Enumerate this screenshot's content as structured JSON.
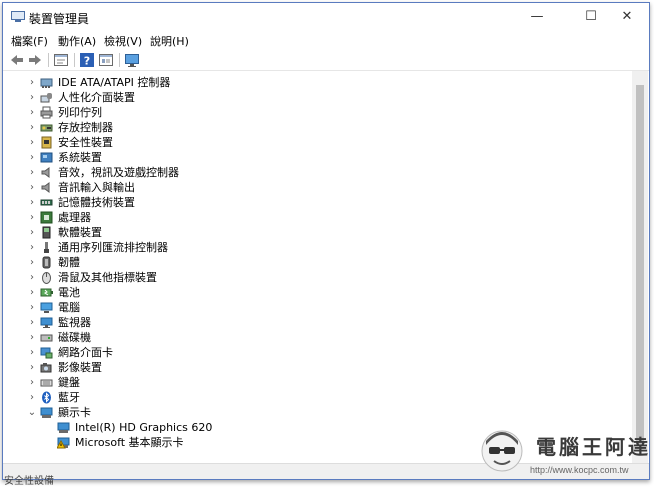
{
  "window": {
    "title": "裝置管理員",
    "minimize": "—",
    "maximize": "☐",
    "close": "✕"
  },
  "menu": [
    {
      "label": "檔案(F)"
    },
    {
      "label": "動作(A)"
    },
    {
      "label": "檢視(V)"
    },
    {
      "label": "說明(H)"
    }
  ],
  "toolbar": {
    "buttons": [
      {
        "icon": "back-arrow-icon"
      },
      {
        "icon": "forward-arrow-icon"
      },
      {
        "icon": "properties-icon"
      },
      {
        "icon": "help-icon"
      },
      {
        "icon": "list-view-icon"
      },
      {
        "icon": "monitor-scan-icon"
      }
    ]
  },
  "tree": {
    "items": [
      {
        "label": "IDE ATA/ATAPI 控制器",
        "icon": "ide-controller-icon",
        "expanded": false
      },
      {
        "label": "人性化介面裝置",
        "icon": "hid-icon",
        "expanded": false
      },
      {
        "label": "列印佇列",
        "icon": "printer-icon",
        "expanded": false
      },
      {
        "label": "存放控制器",
        "icon": "storage-controller-icon",
        "expanded": false
      },
      {
        "label": "安全性裝置",
        "icon": "security-device-icon",
        "expanded": false
      },
      {
        "label": "系統裝置",
        "icon": "system-device-icon",
        "expanded": false
      },
      {
        "label": "音效，視訊及遊戲控制器",
        "icon": "speaker-icon",
        "expanded": false
      },
      {
        "label": "音訊輸入與輸出",
        "icon": "audio-io-icon",
        "expanded": false
      },
      {
        "label": "記憶體技術裝置",
        "icon": "memory-icon",
        "expanded": false
      },
      {
        "label": "處理器",
        "icon": "processor-icon",
        "expanded": false
      },
      {
        "label": "軟體裝置",
        "icon": "software-device-icon",
        "expanded": false
      },
      {
        "label": "通用序列匯流排控制器",
        "icon": "usb-icon",
        "expanded": false
      },
      {
        "label": "韌體",
        "icon": "firmware-icon",
        "expanded": false
      },
      {
        "label": "滑鼠及其他指標裝置",
        "icon": "mouse-icon",
        "expanded": false
      },
      {
        "label": "電池",
        "icon": "battery-icon",
        "expanded": false
      },
      {
        "label": "電腦",
        "icon": "computer-icon",
        "expanded": false
      },
      {
        "label": "監視器",
        "icon": "monitor-icon",
        "expanded": false
      },
      {
        "label": "磁碟機",
        "icon": "disk-drive-icon",
        "expanded": false
      },
      {
        "label": "網路介面卡",
        "icon": "network-adapter-icon",
        "expanded": false
      },
      {
        "label": "影像裝置",
        "icon": "imaging-device-icon",
        "expanded": false
      },
      {
        "label": "鍵盤",
        "icon": "keyboard-icon",
        "expanded": false
      },
      {
        "label": "藍牙",
        "icon": "bluetooth-icon",
        "expanded": false
      },
      {
        "label": "顯示卡",
        "icon": "display-adapter-icon",
        "expanded": true
      }
    ],
    "children": [
      {
        "label": "Intel(R) HD Graphics 620",
        "icon": "display-adapter-icon"
      },
      {
        "label": "Microsoft 基本顯示卡",
        "icon": "display-warning-icon"
      }
    ]
  },
  "statusbar": {
    "text": "安全性設備"
  },
  "watermark": {
    "text": "電腦王阿達",
    "url": "http://www.kocpc.com.tw"
  }
}
